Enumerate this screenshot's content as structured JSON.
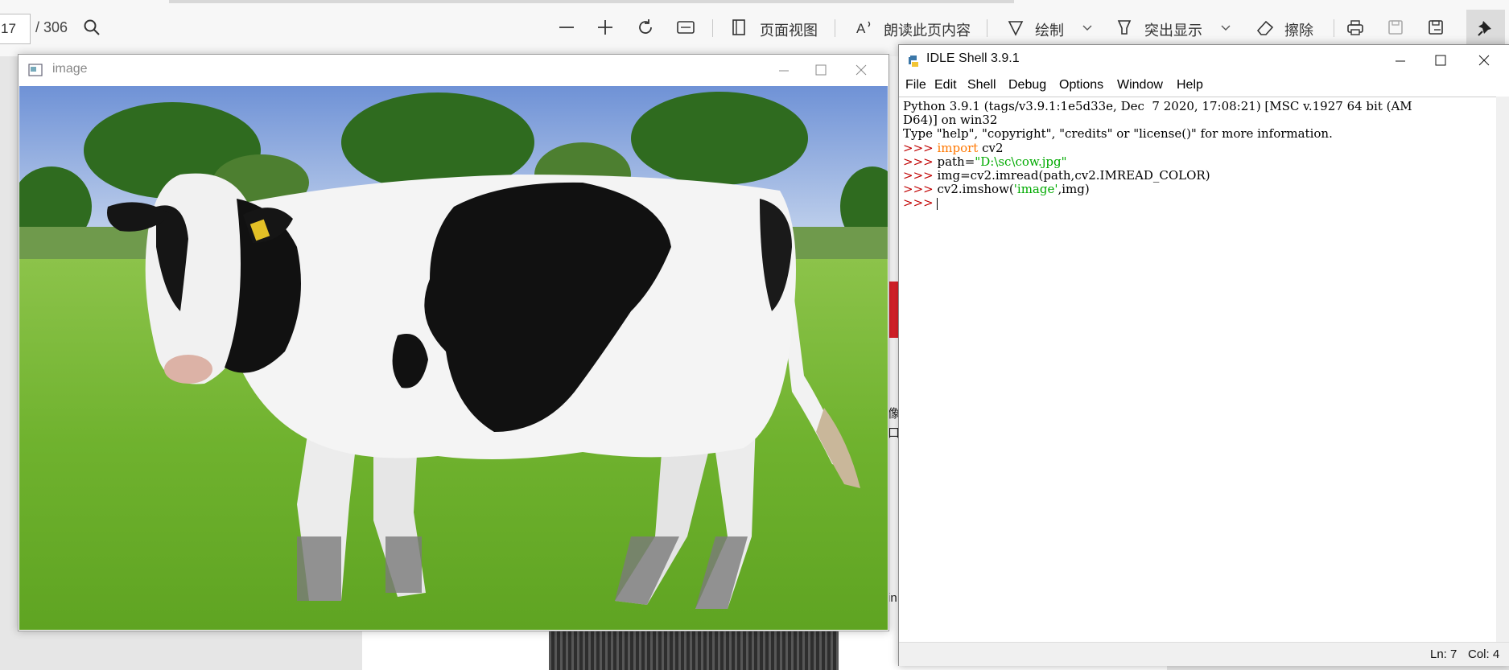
{
  "pdf_toolbar": {
    "page_number": "17",
    "page_total": "/ 306",
    "page_view_label": "页面视图",
    "read_aloud_label": "朗读此页内容",
    "draw_label": "绘制",
    "highlight_label": "突出显示",
    "erase_label": "擦除"
  },
  "background_doc": {
    "side_char_1": "像",
    "side_char_2": "口",
    "side_char_3": "in"
  },
  "image_window": {
    "title": "image"
  },
  "idle_window": {
    "title": "IDLE Shell 3.9.1",
    "menu": [
      "File",
      "Edit",
      "Shell",
      "Debug",
      "Options",
      "Window",
      "Help"
    ],
    "banner_line_1": "Python 3.9.1 (tags/v3.9.1:1e5d33e, Dec  7 2020, 17:08:21) [MSC v.1927 64 bit (AM",
    "banner_line_2": "D64)] on win32",
    "banner_line_3": "Type \"help\", \"copyright\", \"credits\" or \"license()\" for more information.",
    "prompt": ">>> ",
    "line1_kw": "import",
    "line1_rest": " cv2",
    "line2_pre": "path=",
    "line2_str": "\"D:\\sc\\cow.jpg\"",
    "line3": "img=cv2.imread(path,cv2.IMREAD_COLOR)",
    "line4_pre": "cv2.imshow(",
    "line4_str": "'image'",
    "line4_post": ",img)",
    "status_ln": "Ln: 7",
    "status_col": "Col: 4"
  }
}
